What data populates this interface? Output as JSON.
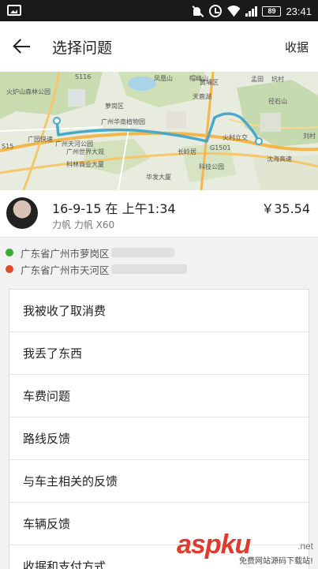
{
  "status_bar": {
    "battery": "89",
    "time": "23:41"
  },
  "header": {
    "title": "选择问题",
    "receipt_label": "收据"
  },
  "map": {
    "labels": [
      "S116",
      "火炉山森林公园",
      "凤凰山",
      "萝岗区",
      "帽峰山",
      "黄埔区",
      "孟田",
      "坑村",
      "天鹿湖",
      "广州华南植物园",
      "广州天河公园",
      "广州世界大观",
      "科林商业大厦",
      "华发大厦",
      "G1501",
      "长岭居",
      "径石山",
      "沈海高速",
      "科技公园",
      "S15",
      "广园快速",
      "刘村",
      "火村立交"
    ],
    "route_color": "#4aa9c9"
  },
  "trip": {
    "datetime": "16-9-15 在 上午1:34",
    "car": "力帆 力帆 X60",
    "price": "￥35.54"
  },
  "addresses": {
    "origin": "广东省广州市萝岗区",
    "destination": "广东省广州市天河区",
    "origin_color": "#3aaa35",
    "destination_color": "#e04a2a"
  },
  "problems": [
    "我被收了取消费",
    "我丢了东西",
    "车费问题",
    "路线反馈",
    "与车主相关的反馈",
    "车辆反馈",
    "收据和支付方式"
  ],
  "watermark": {
    "main": "aspku",
    "suffix": ".net",
    "sub": "免费网站源码下载站!"
  }
}
